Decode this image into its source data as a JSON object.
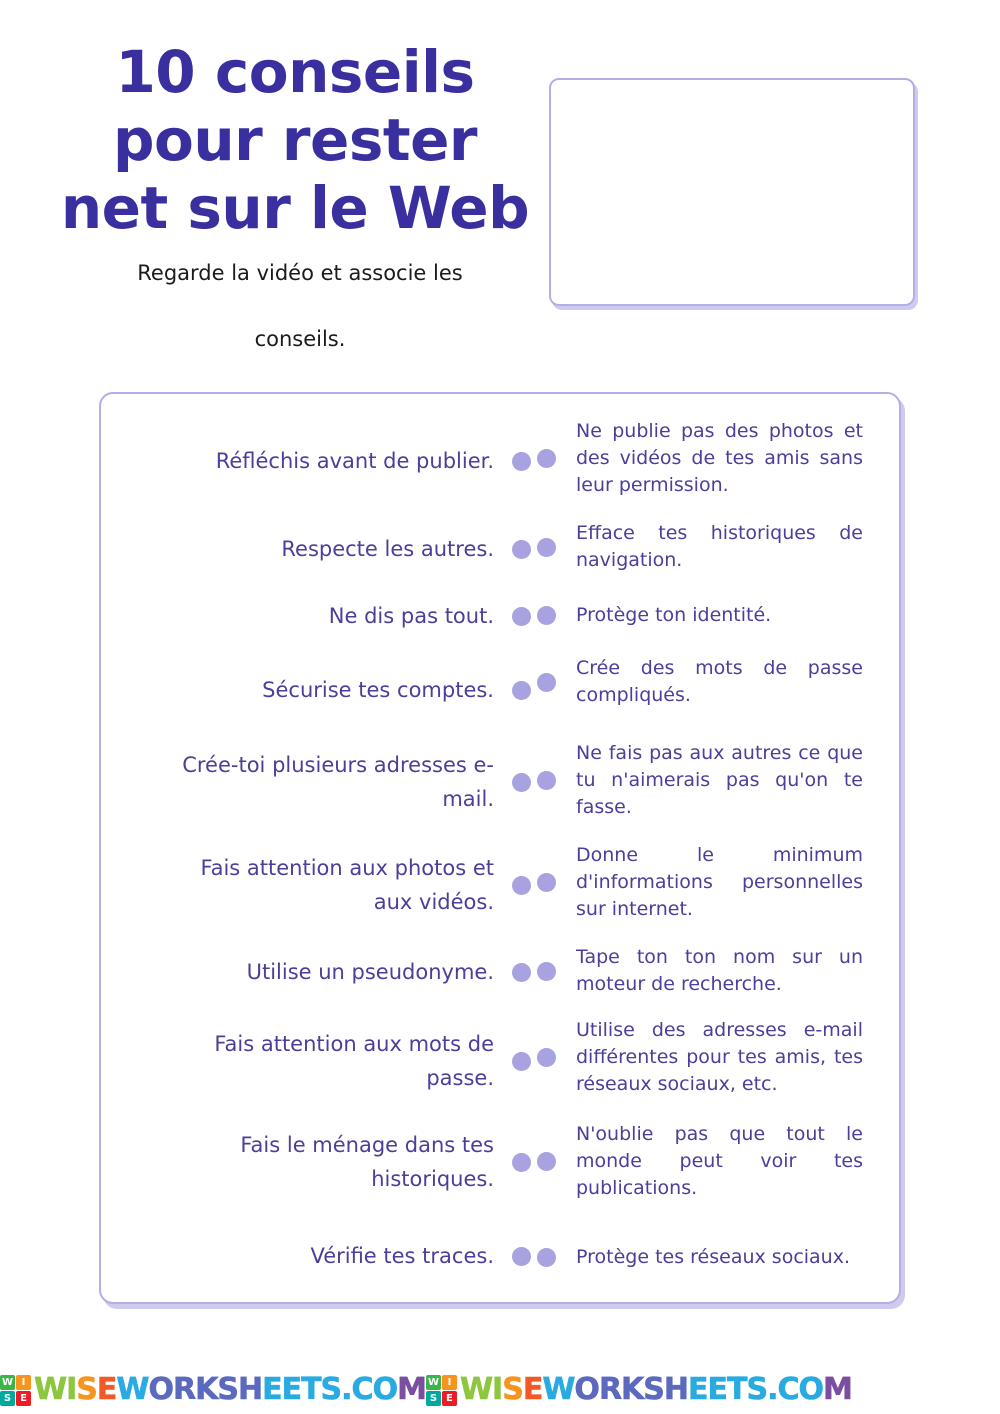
{
  "header": {
    "title": "10 conseils\npour rester\nnet sur le Web",
    "instructions_line1": "Regarde la vidéo et associe les",
    "instructions_line2": "conseils.",
    "video_placeholder_label": "video-area"
  },
  "colors": {
    "title": "#3a2f9e",
    "item_text": "#4a3f99",
    "dot": "#a9a2e0",
    "border": "#b3aee6",
    "instructions": "#1b1b1b",
    "page_background": "#ffffff"
  },
  "matching": {
    "left_items": [
      {
        "id": 1,
        "text": "Réfléchis avant de publier."
      },
      {
        "id": 2,
        "text": "Respecte les autres."
      },
      {
        "id": 3,
        "text": "Ne dis pas tout."
      },
      {
        "id": 4,
        "text": "Sécurise tes comptes."
      },
      {
        "id": 5,
        "text": "Crée-toi plusieurs adresses e-mail."
      },
      {
        "id": 6,
        "text": "Fais attention aux photos et aux vidéos."
      },
      {
        "id": 7,
        "text": "Utilise un pseudonyme."
      },
      {
        "id": 8,
        "text": "Fais attention aux mots de passe."
      },
      {
        "id": 9,
        "text": "Fais le ménage dans tes historiques."
      },
      {
        "id": 10,
        "text": "Vérifie tes traces."
      }
    ],
    "right_items": [
      {
        "id": 1,
        "text": "Ne publie pas des photos et des vidéos de tes amis sans leur permission."
      },
      {
        "id": 2,
        "text": "Efface tes historiques de navigation."
      },
      {
        "id": 3,
        "text": "Protège ton identité."
      },
      {
        "id": 4,
        "text": "Crée des mots de passe compliqués."
      },
      {
        "id": 5,
        "text": "Ne fais pas aux autres ce que tu n'aimerais pas qu'on te fasse."
      },
      {
        "id": 6,
        "text": "Donne le minimum d'informations personnelles sur internet."
      },
      {
        "id": 7,
        "text": "Tape ton ton nom sur un moteur de recherche."
      },
      {
        "id": 8,
        "text": "Utilise des adresses e-mail différentes pour tes amis, tes réseaux sociaux, etc."
      },
      {
        "id": 9,
        "text": "N'oublie pas que tout le monde peut voir tes publications."
      },
      {
        "id": 10,
        "text": "Protège tes réseaux sociaux."
      }
    ]
  },
  "footer": {
    "watermark_text": "WISEWORKSHEETS.COM",
    "logo_letters": [
      "W",
      "I",
      "S",
      "E"
    ],
    "repeat_count": 2,
    "letter_colors": [
      "#8dc63f",
      "#8dc63f",
      "#f7941e",
      "#f15a24",
      "#29abe2",
      "#5b6abf",
      "#5b6abf",
      "#5b6abf",
      "#5b6abf",
      "#5b6abf",
      "#29abe2",
      "#29abe2",
      "#29abe2",
      "#29abe2",
      "#29abe2",
      "#29abe2",
      "#29abe2",
      "#7b4fa0",
      "#a3348e",
      "#ed1c24"
    ]
  }
}
